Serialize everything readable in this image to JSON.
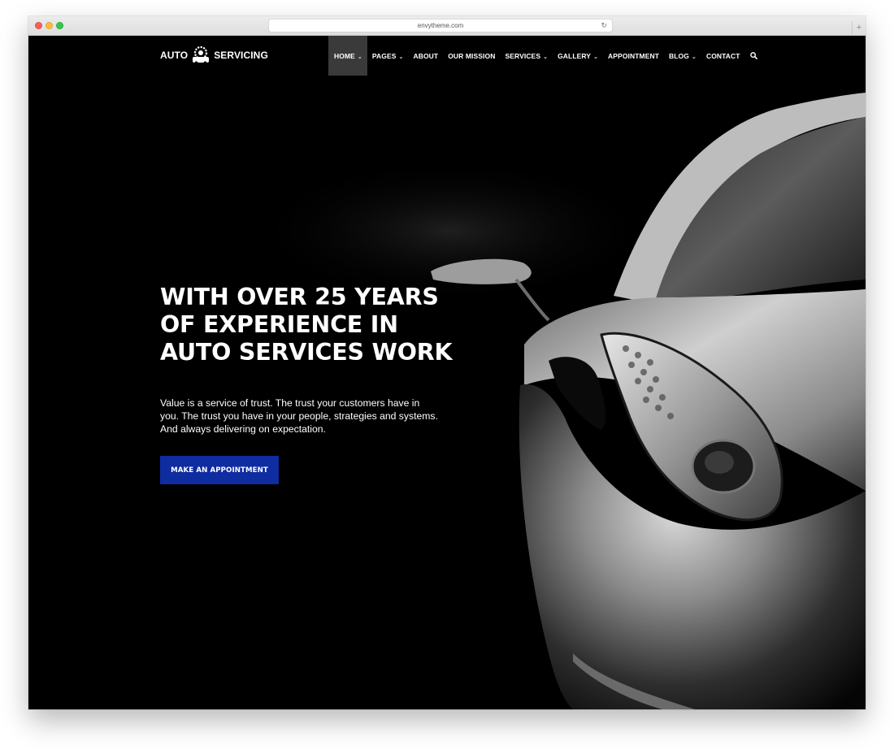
{
  "browser": {
    "url": "envytheme.com"
  },
  "logo": {
    "left": "AUTO",
    "right": "SERVICING",
    "icon": "gear-car-badge-icon"
  },
  "nav": {
    "items": [
      {
        "label": "HOME",
        "dropdown": true,
        "active": true
      },
      {
        "label": "PAGES",
        "dropdown": true
      },
      {
        "label": "ABOUT",
        "dropdown": false
      },
      {
        "label": "OUR MISSION",
        "dropdown": false
      },
      {
        "label": "SERVICES",
        "dropdown": true
      },
      {
        "label": "GALLERY",
        "dropdown": true
      },
      {
        "label": "APPOINTMENT",
        "dropdown": false
      },
      {
        "label": "BLOG",
        "dropdown": true
      },
      {
        "label": "CONTACT",
        "dropdown": false
      }
    ],
    "search_icon": "search-icon",
    "caret": "⌄"
  },
  "hero": {
    "title_line1": "WITH OVER 25 YEARS",
    "title_line2": "OF EXPERIENCE IN",
    "title_line3": "AUTO SERVICES WORK",
    "text_line1": "Value is a service of trust. The trust your customers have in",
    "text_line2": "you. The trust you have in your people, strategies and systems.",
    "text_line3": "And always delivering on expectation.",
    "cta_label": "MAKE AN APPOINTMENT"
  },
  "colors": {
    "background": "#000000",
    "accent": "#0f2ca0",
    "nav_active": "#3a3a3a"
  }
}
